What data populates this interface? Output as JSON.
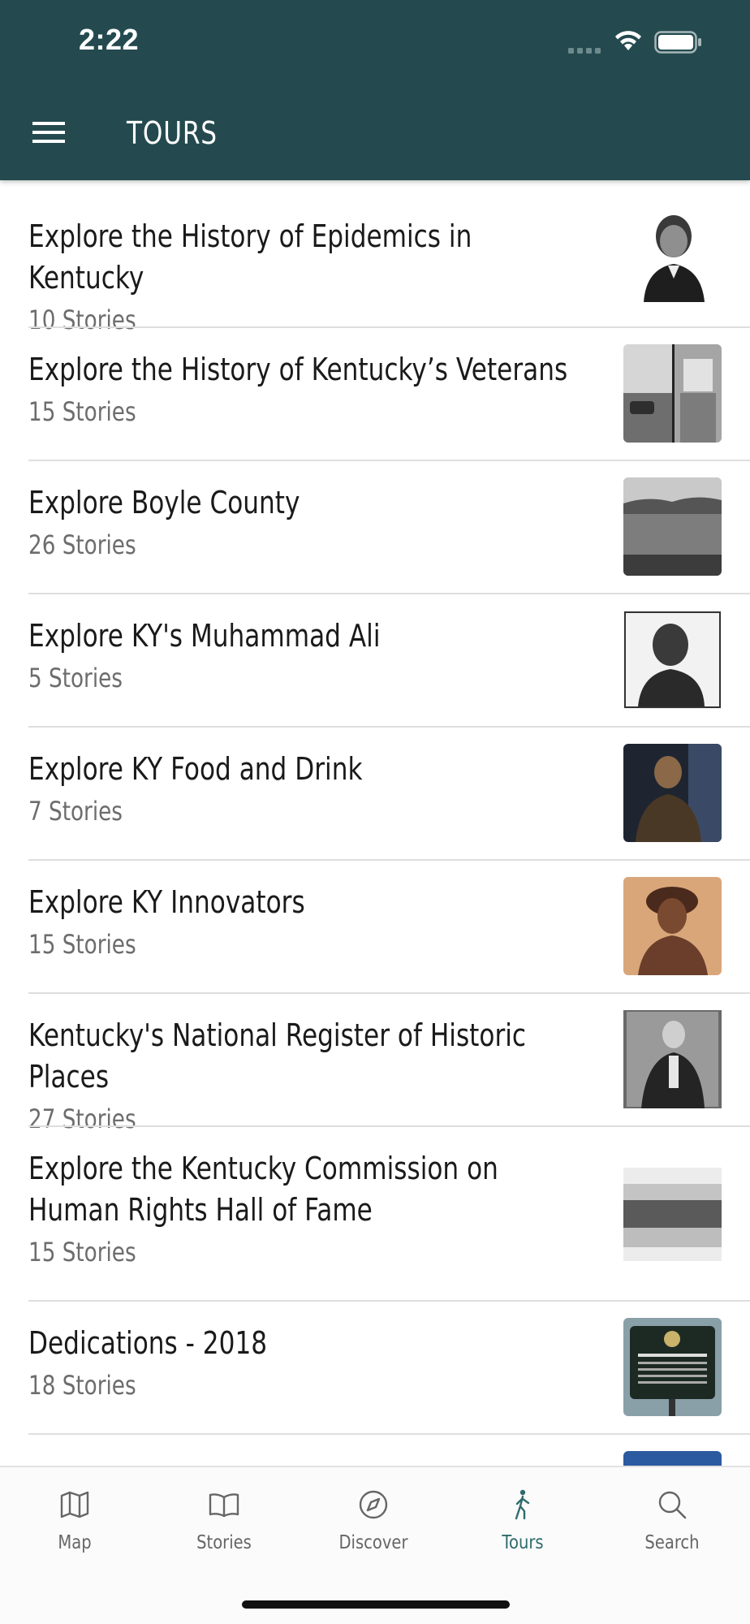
{
  "status_bar": {
    "time": "2:22"
  },
  "header": {
    "title": "TOURS"
  },
  "tours": [
    {
      "title": "Explore the History of Epidemics in Kentucky",
      "count": "10 Stories"
    },
    {
      "title": "Explore the History of Kentucky’s Veterans",
      "count": "15 Stories"
    },
    {
      "title": "Explore Boyle County",
      "count": "26 Stories"
    },
    {
      "title": "Explore KY's Muhammad Ali",
      "count": "5 Stories"
    },
    {
      "title": "Explore KY Food and Drink",
      "count": "7 Stories"
    },
    {
      "title": "Explore KY Innovators",
      "count": "15 Stories"
    },
    {
      "title": "Kentucky's National Register of Historic Places",
      "count": "27 Stories"
    },
    {
      "title": "Explore the Kentucky Commission on Human Rights Hall of Fame",
      "count": "15 Stories"
    },
    {
      "title": "Dedications - 2018",
      "count": "18 Stories"
    }
  ],
  "tabs": {
    "map": "Map",
    "stories": "Stories",
    "discover": "Discover",
    "tours": "Tours",
    "search": "Search"
  },
  "colors": {
    "header_bg": "#244a4f",
    "active_tab": "#2f6b6d",
    "inactive_tab": "#666666"
  }
}
